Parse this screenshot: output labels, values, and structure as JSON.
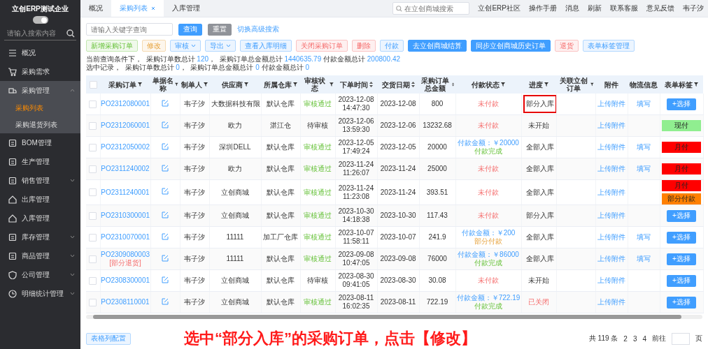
{
  "sidebar": {
    "company": "立创ERP测试企业",
    "toggle_on": true,
    "search_placeholder": "请输入搜索内容",
    "items": [
      {
        "label": "概况",
        "submenu": false,
        "expanded": false
      },
      {
        "label": "采购需求",
        "submenu": false,
        "expanded": false
      },
      {
        "label": "采购管理",
        "submenu": true,
        "expanded": true,
        "children": [
          {
            "label": "采购列表",
            "selected": true
          },
          {
            "label": "采购退货列表",
            "selected": false
          }
        ]
      },
      {
        "label": "BOM管理",
        "submenu": false,
        "expanded": false
      },
      {
        "label": "生产管理",
        "submenu": false,
        "expanded": false
      },
      {
        "label": "销售管理",
        "submenu": true,
        "expanded": false
      },
      {
        "label": "出库管理",
        "submenu": false,
        "expanded": false
      },
      {
        "label": "入库管理",
        "submenu": false,
        "expanded": false
      },
      {
        "label": "库存管理",
        "submenu": true,
        "expanded": false
      },
      {
        "label": "商品管理",
        "submenu": true,
        "expanded": false
      },
      {
        "label": "公司管理",
        "submenu": true,
        "expanded": false
      },
      {
        "label": "明细统计管理",
        "submenu": true,
        "expanded": false
      }
    ]
  },
  "tabs": [
    {
      "label": "概况",
      "selected": false,
      "closable": false
    },
    {
      "label": "采购列表",
      "selected": true,
      "closable": true
    },
    {
      "label": "入库管理",
      "selected": false,
      "closable": false
    }
  ],
  "top_search_placeholder": "在立创商城搜索",
  "top_links": [
    "立创ERP社区",
    "操作手册",
    "消息",
    "刷新",
    "联系客服",
    "意见反馈",
    "韦子汐"
  ],
  "query": {
    "placeholder": "请输入关键字查询",
    "search": "查询",
    "reset": "重置",
    "advanced": "切换高级搜索"
  },
  "actions": [
    {
      "label": "新增采购订单",
      "kind": "success",
      "dropdown": false
    },
    {
      "label": "修改",
      "kind": "warning",
      "dropdown": false
    },
    {
      "label": "审核",
      "kind": "info",
      "dropdown": true
    },
    {
      "label": "导出",
      "kind": "info",
      "dropdown": true
    },
    {
      "label": "查看入库明细",
      "kind": "info",
      "dropdown": false
    },
    {
      "label": "关闭采购订单",
      "kind": "danger",
      "dropdown": false
    },
    {
      "label": "删除",
      "kind": "danger",
      "dropdown": false
    },
    {
      "label": "付款",
      "kind": "info",
      "dropdown": false
    },
    {
      "label": "去立创商城结算",
      "kind": "primary",
      "dropdown": false
    },
    {
      "label": "同步立创商城历史订单",
      "kind": "primary",
      "dropdown": false
    },
    {
      "label": "退货",
      "kind": "danger",
      "dropdown": false
    },
    {
      "label": "表单标签管理",
      "kind": "info",
      "dropdown": false
    }
  ],
  "summary": [
    [
      {
        "text": "当前查询条件下，  采购订单数总计 ",
        "kind": "plain"
      },
      {
        "text": "120",
        "kind": "value"
      },
      {
        "text": "，  采购订单总金额总计 ",
        "kind": "plain"
      },
      {
        "text": "1440635.79",
        "kind": "value"
      },
      {
        "text": " 付款金额总计 ",
        "kind": "plain"
      },
      {
        "text": "200800.42",
        "kind": "value"
      }
    ],
    [
      {
        "text": "选中记录，  采购订单数总计 ",
        "kind": "plain"
      },
      {
        "text": "0",
        "kind": "value"
      },
      {
        "text": "，  采购订单总金额总计 ",
        "kind": "plain"
      },
      {
        "text": "0",
        "kind": "value"
      },
      {
        "text": " 付款金额总计 ",
        "kind": "plain"
      },
      {
        "text": "0",
        "kind": "value"
      }
    ]
  ],
  "table": {
    "select_all_checked": false,
    "columns": [
      {
        "label": "采购订单",
        "kind": "filter"
      },
      {
        "label": "单据名称",
        "kind": "filter"
      },
      {
        "label": "制单人",
        "kind": "filter"
      },
      {
        "label": "供应商",
        "kind": "filter"
      },
      {
        "label": "所属仓库",
        "kind": "filter"
      },
      {
        "label": "审核状态",
        "kind": "filter"
      },
      {
        "label": "下单时间",
        "kind": "sort"
      },
      {
        "label": "交货日期",
        "kind": "sort"
      },
      {
        "label": "采购订单总金额",
        "kind": "sort"
      },
      {
        "label": "付款状态",
        "kind": "filter"
      },
      {
        "label": "进度",
        "kind": "filter"
      },
      {
        "label": "关联立创订单",
        "kind": "filter"
      },
      {
        "label": "附件",
        "kind": "plain"
      },
      {
        "label": "物流信息",
        "kind": "plain"
      },
      {
        "label": "表单标签",
        "kind": "filter"
      }
    ],
    "rows": [
      {
        "checked": false,
        "order": "PO2312080001",
        "creator": "韦子汐",
        "supplier": "大数据科技有限",
        "warehouse": "默认仓库",
        "audit": "审核通过",
        "audit_approved": true,
        "order_date": "2023-12-08",
        "order_time": "14:47:30",
        "delivery": "2023-12-08",
        "total": "800",
        "payment": {
          "kind": "unpaid",
          "status": "未付款"
        },
        "progress": "部分入库",
        "progress_closed": false,
        "highlighted": true,
        "attachment": "上传附件",
        "logistics": "填写",
        "tags": [],
        "select_label": "+选择"
      },
      {
        "checked": false,
        "order": "PO2312060001",
        "creator": "韦子汐",
        "supplier": "欧力",
        "warehouse": "湛江仓",
        "audit": "待审核",
        "audit_approved": false,
        "order_date": "2023-12-06",
        "order_time": "13:59:30",
        "delivery": "2023-12-06",
        "total": "13232.68",
        "payment": {
          "kind": "unpaid",
          "status": "未付款"
        },
        "progress": "未开始",
        "progress_closed": false,
        "highlighted": false,
        "attachment": "上传附件",
        "tags": [
          {
            "label": "现付",
            "color": "#90ee90"
          }
        ]
      },
      {
        "checked": false,
        "order": "PO2312050002",
        "creator": "韦子汐",
        "supplier": "深圳DELL",
        "warehouse": "默认仓库",
        "audit": "审核通过",
        "audit_approved": true,
        "order_date": "2023-12-05",
        "order_time": "17:49:24",
        "delivery": "2023-12-05",
        "total": "20000",
        "payment": {
          "kind": "done",
          "amount": "付款金额：￥20000",
          "status": "付款完成"
        },
        "progress": "全部入库",
        "progress_closed": false,
        "highlighted": false,
        "attachment": "上传附件",
        "logistics": "填写",
        "tags": [
          {
            "label": "月付",
            "color": "#ff0000"
          }
        ]
      },
      {
        "checked": false,
        "order": "PO2311240002",
        "creator": "韦子汐",
        "supplier": "欧力",
        "warehouse": "默认仓库",
        "audit": "审核通过",
        "audit_approved": true,
        "order_date": "2023-11-24",
        "order_time": "11:26:07",
        "delivery": "2023-11-24",
        "total": "25000",
        "payment": {
          "kind": "unpaid",
          "status": "未付款"
        },
        "progress": "全部入库",
        "progress_closed": false,
        "highlighted": false,
        "attachment": "上传附件",
        "logistics": "填写",
        "tags": [
          {
            "label": "月付",
            "color": "#ff0000"
          }
        ]
      },
      {
        "checked": false,
        "order": "PO2311240001",
        "creator": "韦子汐",
        "supplier": "立创商城",
        "warehouse": "默认仓库",
        "audit": "审核通过",
        "audit_approved": true,
        "order_date": "2023-11-24",
        "order_time": "11:23:08",
        "delivery": "2023-11-24",
        "total": "393.51",
        "payment": {
          "kind": "unpaid",
          "status": "未付款"
        },
        "progress": "全部入库",
        "progress_closed": false,
        "highlighted": false,
        "attachment": "上传附件",
        "tags": [
          {
            "label": "月付",
            "color": "#ff0000"
          },
          {
            "label": "部分付款",
            "color": "#ff8000"
          }
        ]
      },
      {
        "checked": false,
        "order": "PO2310300001",
        "creator": "韦子汐",
        "supplier": "立创商城",
        "warehouse": "默认仓库",
        "audit": "审核通过",
        "audit_approved": true,
        "order_date": "2023-10-30",
        "order_time": "14:18:38",
        "delivery": "2023-10-30",
        "total": "117.43",
        "payment": {
          "kind": "unpaid",
          "status": "未付款"
        },
        "progress": "部分入库",
        "progress_closed": false,
        "highlighted": false,
        "attachment": "上传附件",
        "tags": [],
        "select_label": "+选择"
      },
      {
        "checked": false,
        "order": "PO2310070001",
        "creator": "韦子汐",
        "supplier": "11111",
        "warehouse": "加工厂仓库",
        "audit": "审核通过",
        "audit_approved": true,
        "order_date": "2023-10-07",
        "order_time": "11:58:11",
        "delivery": "2023-10-07",
        "total": "241.9",
        "payment": {
          "kind": "partial",
          "amount": "付款金额：￥200",
          "status": "部分付款"
        },
        "progress": "全部入库",
        "progress_closed": false,
        "highlighted": false,
        "attachment": "上传附件",
        "logistics": "填写",
        "tags": [],
        "select_label": "+选择"
      },
      {
        "checked": false,
        "order": "PO2309080003",
        "note": "[部分退货]",
        "creator": "韦子汐",
        "supplier": "11111",
        "warehouse": "默认仓库",
        "audit": "审核通过",
        "audit_approved": true,
        "order_date": "2023-09-08",
        "order_time": "10:47:05",
        "delivery": "2023-09-08",
        "total": "76000",
        "payment": {
          "kind": "done",
          "amount": "付款金额：￥86000",
          "status": "付款完成"
        },
        "progress": "全部入库",
        "progress_closed": false,
        "highlighted": false,
        "attachment": "上传附件",
        "logistics": "填写",
        "tags": [],
        "select_label": "+选择"
      },
      {
        "checked": false,
        "order": "PO2308300001",
        "creator": "韦子汐",
        "supplier": "立创商城",
        "warehouse": "默认仓库",
        "audit": "待审核",
        "audit_approved": false,
        "order_date": "2023-08-30",
        "order_time": "09:41:05",
        "delivery": "2023-08-30",
        "total": "30.08",
        "payment": {
          "kind": "unpaid",
          "status": "未付款"
        },
        "progress": "未开始",
        "progress_closed": false,
        "highlighted": false,
        "attachment": "上传附件",
        "tags": [],
        "select_label": "+选择"
      },
      {
        "checked": false,
        "order": "PO2308110001",
        "creator": "韦子汐",
        "supplier": "立创商城",
        "warehouse": "默认仓库",
        "audit": "审核通过",
        "audit_approved": true,
        "order_date": "2023-08-11",
        "order_time": "16:02:35",
        "delivery": "2023-08-11",
        "total": "722.19",
        "payment": {
          "kind": "done",
          "amount": "付款金额：￥722.19",
          "status": "付款完成"
        },
        "progress": "已关闭",
        "progress_closed": true,
        "highlighted": false,
        "attachment": "上传附件",
        "tags": [],
        "select_label": "+选择"
      }
    ]
  },
  "footer": {
    "column_config": "表格列配置",
    "caption": "选中“部分入库”的采购订单，点击【修改】",
    "pagination": {
      "total": "共 119 条",
      "pages": [
        "2",
        "3",
        "4"
      ],
      "goto": "前往",
      "page_unit": "页"
    }
  }
}
